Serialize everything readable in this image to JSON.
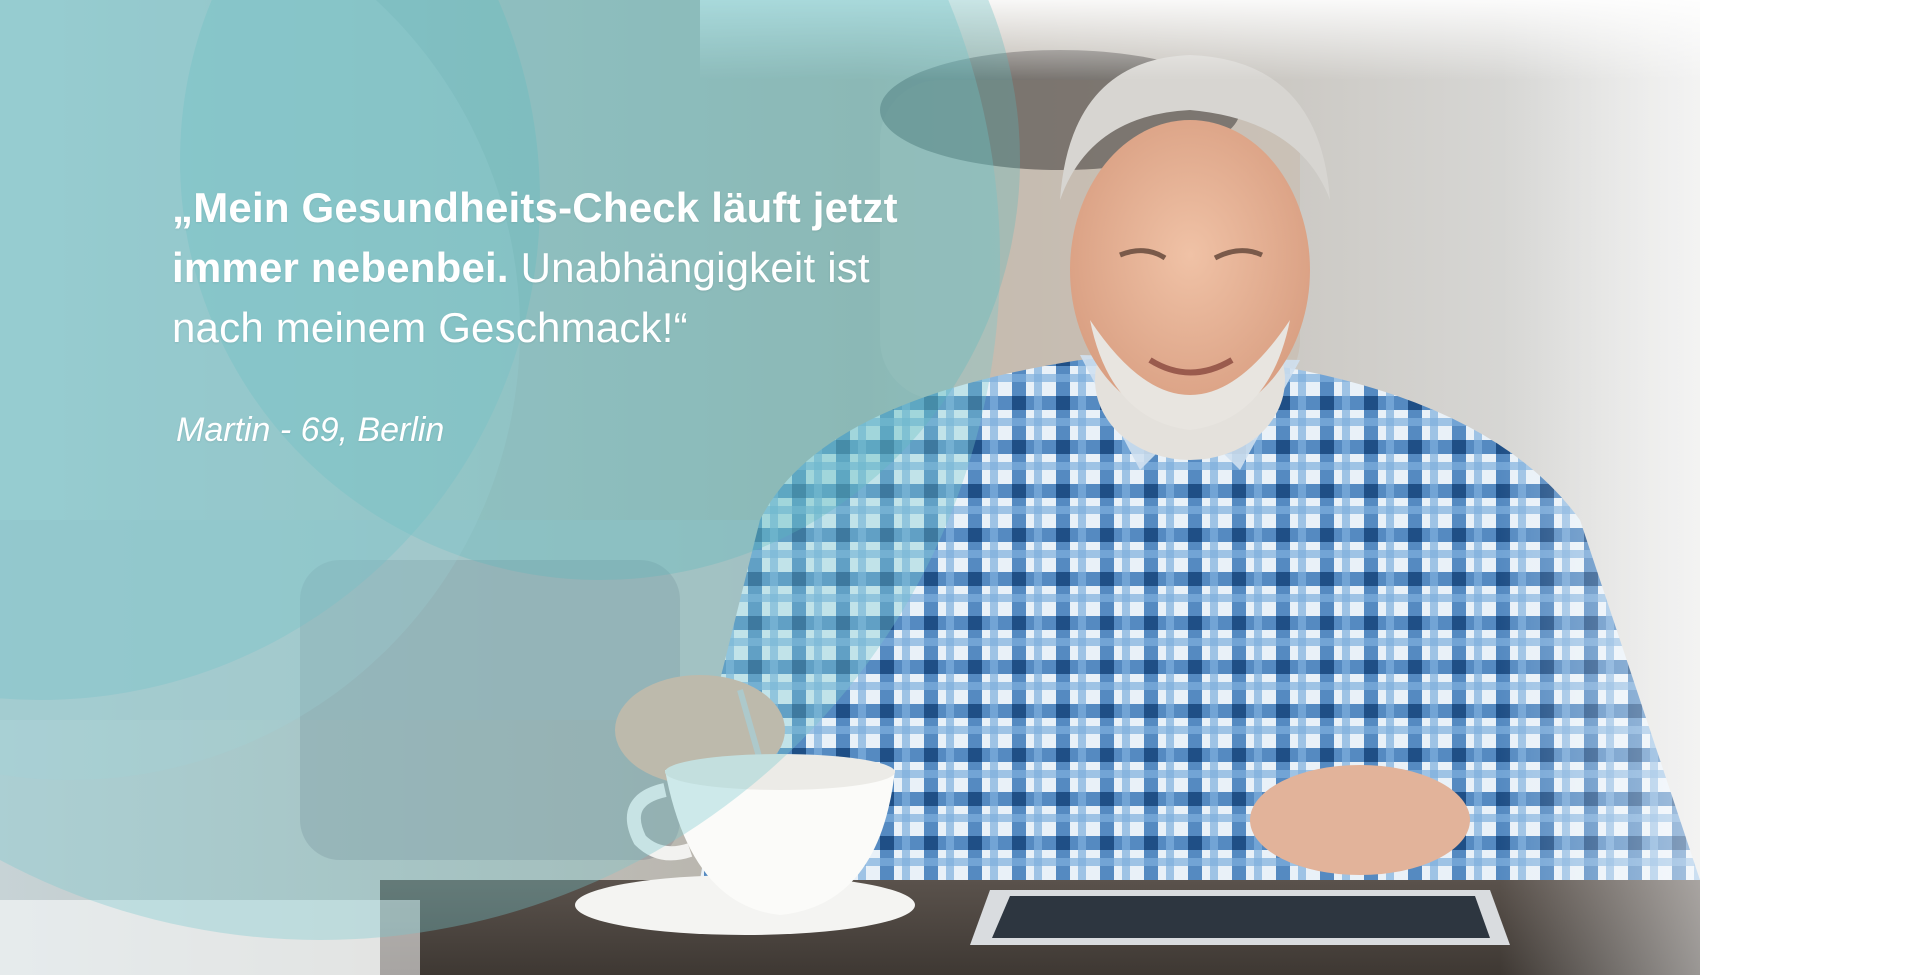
{
  "hero": {
    "quote_bold": "„Mein Gesundheits-Check läuft jetzt immer nebenbei.",
    "quote_regular": "Unabhängigkeit ist nach meinem Geschmack!“",
    "author": "Martin - 69, Berlin",
    "image_subject": "older man in blue checked shirt with coffee cup using a tablet"
  },
  "colors": {
    "teal_overlay": "#5fbfc4",
    "text": "#ffffff",
    "shirt_blue": "#3d7fc0"
  }
}
